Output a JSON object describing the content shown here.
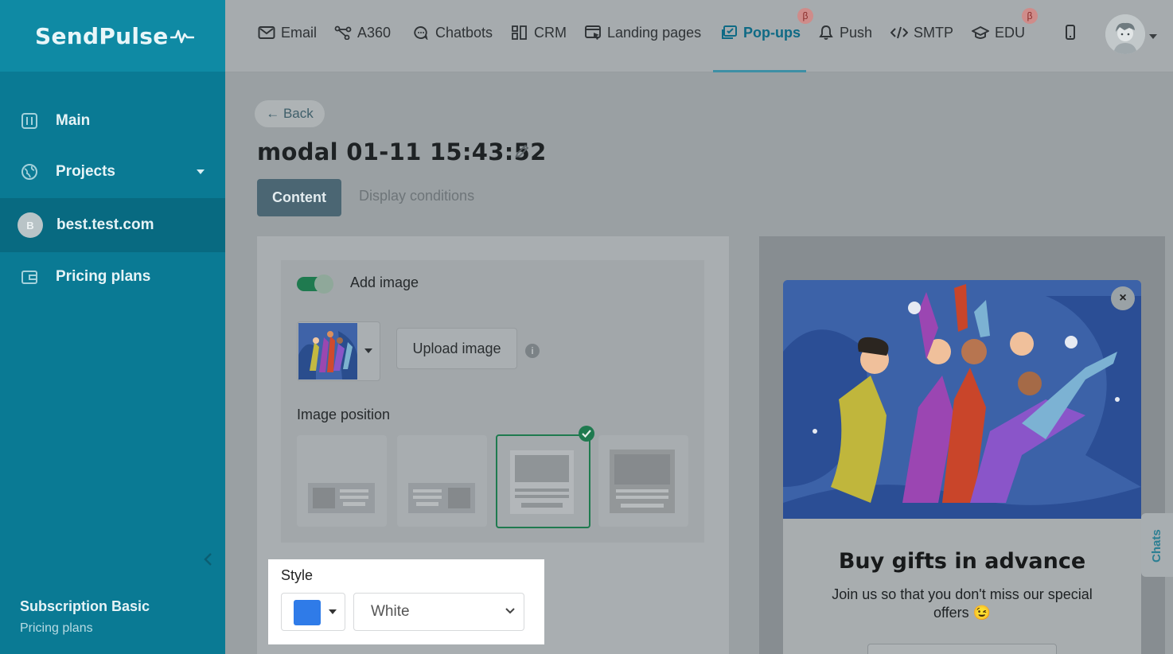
{
  "brand": {
    "name": "SendPulse"
  },
  "sidebar": {
    "items": [
      {
        "label": "Main",
        "icon": "dashboard-icon"
      },
      {
        "label": "Projects",
        "icon": "globe-icon"
      },
      {
        "label": "best.test.com",
        "avatar_letter": "B"
      },
      {
        "label": "Pricing plans",
        "icon": "wallet-icon"
      }
    ],
    "subscription": {
      "title": "Subscription Basic",
      "link": "Pricing plans"
    }
  },
  "topnav": {
    "items": [
      {
        "label": "Email",
        "icon": "mail-icon"
      },
      {
        "label": "A360",
        "icon": "nodes-icon"
      },
      {
        "label": "Chatbots",
        "icon": "chat-icon"
      },
      {
        "label": "CRM",
        "icon": "kanban-icon"
      },
      {
        "label": "Landing pages",
        "icon": "landing-icon"
      },
      {
        "label": "Pop-ups",
        "icon": "popup-icon",
        "active": true,
        "beta": "β"
      },
      {
        "label": "Push",
        "icon": "bell-icon"
      },
      {
        "label": "SMTP",
        "icon": "code-icon"
      },
      {
        "label": "EDU",
        "icon": "graduation-cap-icon",
        "beta": "β"
      }
    ],
    "accent": "#0e6a85"
  },
  "page": {
    "back_label": "← Back",
    "title": "modal 01-11 15:43:52",
    "tabs": [
      {
        "label": "Content",
        "active": true
      },
      {
        "label": "Display conditions"
      }
    ]
  },
  "editor": {
    "add_image": {
      "label": "Add image",
      "enabled": true
    },
    "upload_label": "Upload image",
    "info_glyph": "i",
    "image_position": {
      "label": "Image position",
      "selected_index": 2
    },
    "style": {
      "label": "Style",
      "color": "#2f7be8",
      "selected": "White"
    }
  },
  "preview": {
    "close_glyph": "×",
    "title": "Buy gifts in advance",
    "text": "Join us so that you don't miss our special offers 😉"
  },
  "chats_label": "Chats"
}
